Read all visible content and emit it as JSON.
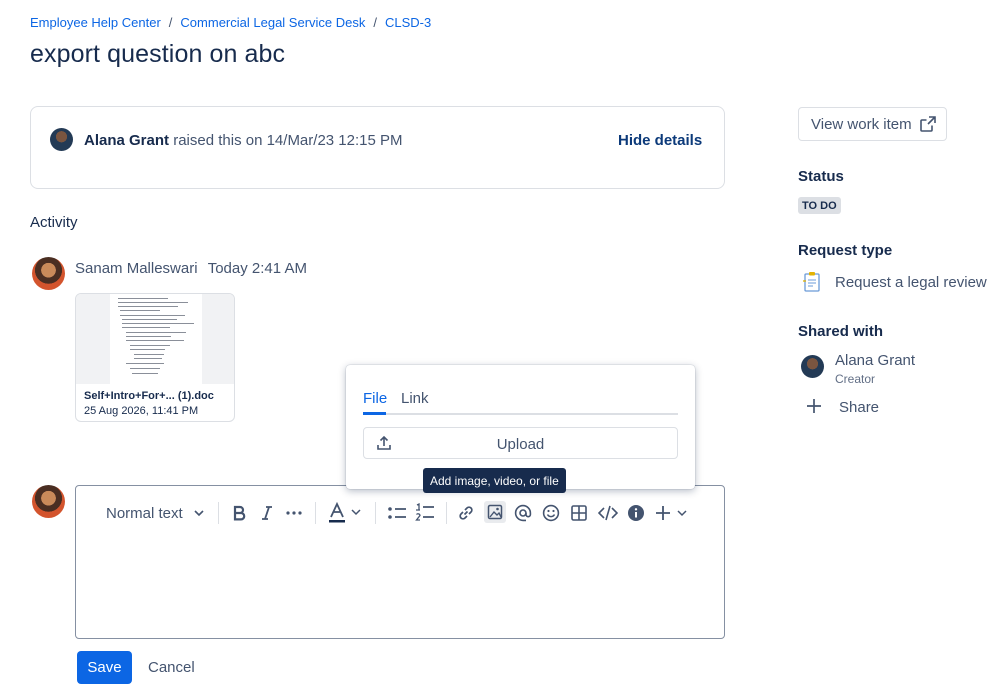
{
  "breadcrumb": {
    "items": [
      "Employee Help Center",
      "Commercial Legal Service Desk",
      "CLSD-3"
    ],
    "separator": "/"
  },
  "page_title": "export question on abc",
  "request": {
    "reporter": "Alana Grant",
    "raised_text": "raised this on 14/Mar/23 12:15 PM",
    "hide_details_label": "Hide details"
  },
  "activity": {
    "heading": "Activity",
    "comment": {
      "author": "Sanam Malleswari",
      "time": "Today 2:41 AM",
      "attachment": {
        "name": "Self+Intro+For+... (1).doc",
        "date": "25 Aug 2026, 11:41 PM"
      }
    }
  },
  "editor": {
    "text_style_label": "Normal text",
    "toolbar_icons": [
      "bold-icon",
      "italic-icon",
      "more-formatting-icon",
      "text-color-icon",
      "bullet-list-icon",
      "numbered-list-icon",
      "link-icon",
      "image-icon",
      "mention-icon",
      "emoji-icon",
      "table-icon",
      "code-icon",
      "info-panel-icon",
      "insert-plus-icon"
    ],
    "save_label": "Save",
    "cancel_label": "Cancel"
  },
  "media_popup": {
    "tabs": [
      "File",
      "Link"
    ],
    "active_tab": "File",
    "upload_label": "Upload",
    "tooltip": "Add image, video, or file"
  },
  "sidebar": {
    "view_work_item_label": "View work item",
    "status_heading": "Status",
    "status_value": "TO DO",
    "request_type_heading": "Request type",
    "request_type_value": "Request a legal review",
    "shared_with_heading": "Shared with",
    "shared_user_name": "Alana Grant",
    "shared_user_role": "Creator",
    "share_label": "Share"
  },
  "colors": {
    "link": "#0c66e4",
    "primary_button": "#0c66e4",
    "text": "#172b4d",
    "subtle_text": "#44546f",
    "tooltip_bg": "#172b4d"
  }
}
